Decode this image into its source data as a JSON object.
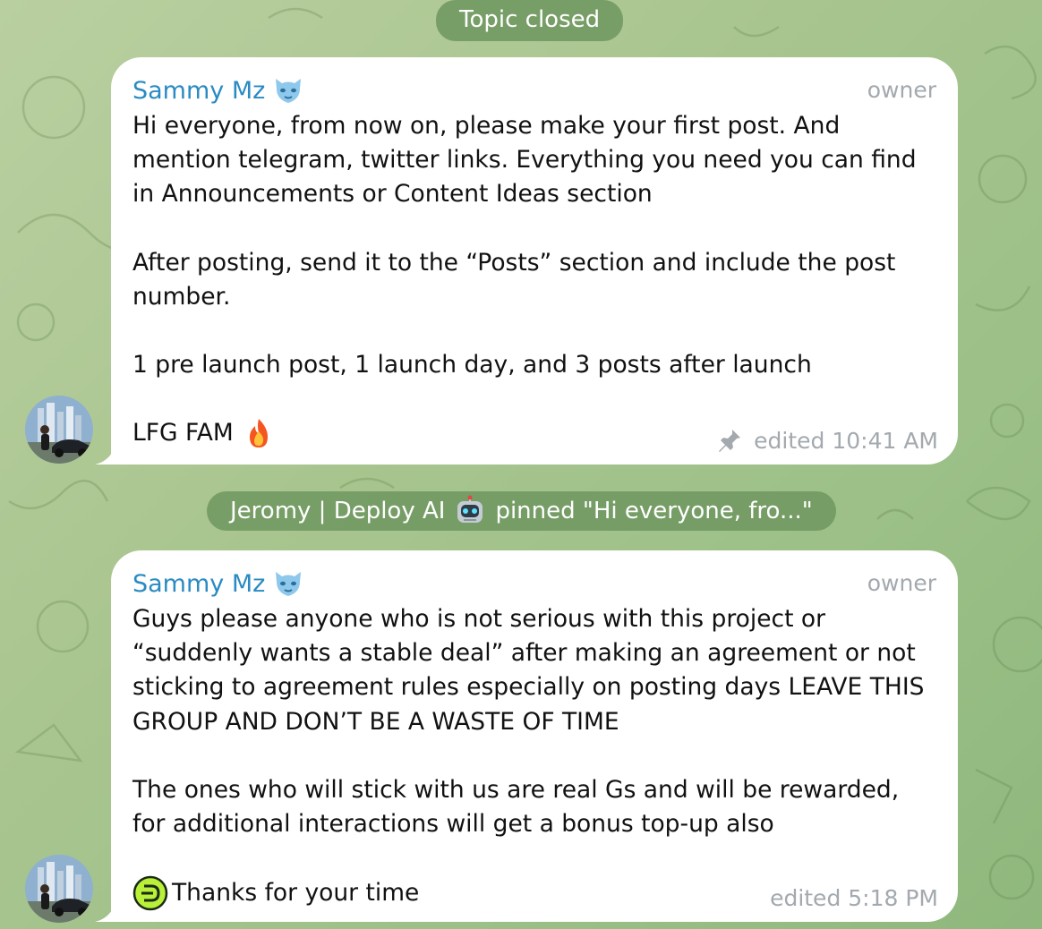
{
  "service_messages": {
    "topic_closed": "Topic closed",
    "pin_actor": "Jeromy | Deploy AI",
    "pin_text": "pinned \"Hi everyone, fro...\""
  },
  "messages": [
    {
      "sender": "Sammy Mz",
      "role": "owner",
      "paragraphs": [
        "Hi everyone, from now on, please make your first post. And mention telegram, twitter links. Everything you need you can find in Announcements or Content Ideas section",
        "After posting, send it to the “Posts” section and include the post number.",
        "1 pre launch post, 1 launch day, and 3 posts after launch",
        "LFG FAM"
      ],
      "meta": "edited 10:41 AM",
      "icons": [
        "panther-emoji",
        "fire-emoji",
        "pin-icon"
      ]
    },
    {
      "sender": "Sammy Mz",
      "role": "owner",
      "paragraphs": [
        "Guys please anyone who is not serious with this project or “suddenly wants a stable deal” after making an agreement or not sticking to agreement rules especially on posting days LEAVE THIS GROUP AND DON’T BE A WASTE OF TIME",
        "The ones who will stick with us are real Gs and will be rewarded, for additional interactions will get a bonus top-up also",
        "Thanks for your time"
      ],
      "meta": "edited 5:18 PM",
      "icons": [
        "panther-emoji",
        "deploy-logo-emoji"
      ]
    }
  ],
  "colors": {
    "sender_name": "#2a8bc2",
    "muted": "#a3a9ae",
    "service_pill": "#6e965f",
    "wallpaper": "#a9c58f"
  }
}
